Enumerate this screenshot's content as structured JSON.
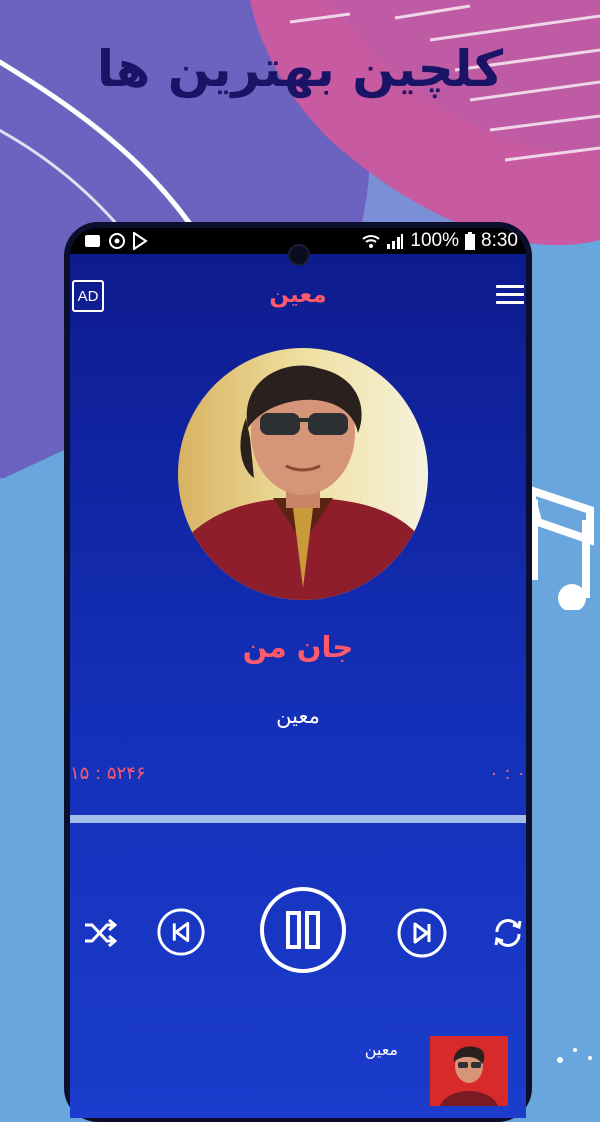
{
  "promo": {
    "title": "کلچین بهترین ها"
  },
  "status_bar": {
    "battery": "100%",
    "time": "8:30"
  },
  "app_bar": {
    "ad_label": "AD",
    "title": "معین"
  },
  "now_playing": {
    "song_title": "جان من",
    "artist": "معین",
    "elapsed": "۰ : ۰",
    "duration": "۵۲۴۶ : ۱۵",
    "progress_fraction": 0.0
  },
  "controls": {
    "shuffle": "shuffle-icon",
    "previous": "skip-previous-icon",
    "play_pause": "pause-icon",
    "next": "skip-next-icon",
    "repeat": "repeat-icon"
  },
  "mini_player": {
    "artist": "معین"
  },
  "colors": {
    "accent": "#ff5a6b",
    "screen_bg": "#1430b8",
    "page_bg": "#6aa6de",
    "promo_title": "#1a1466"
  }
}
